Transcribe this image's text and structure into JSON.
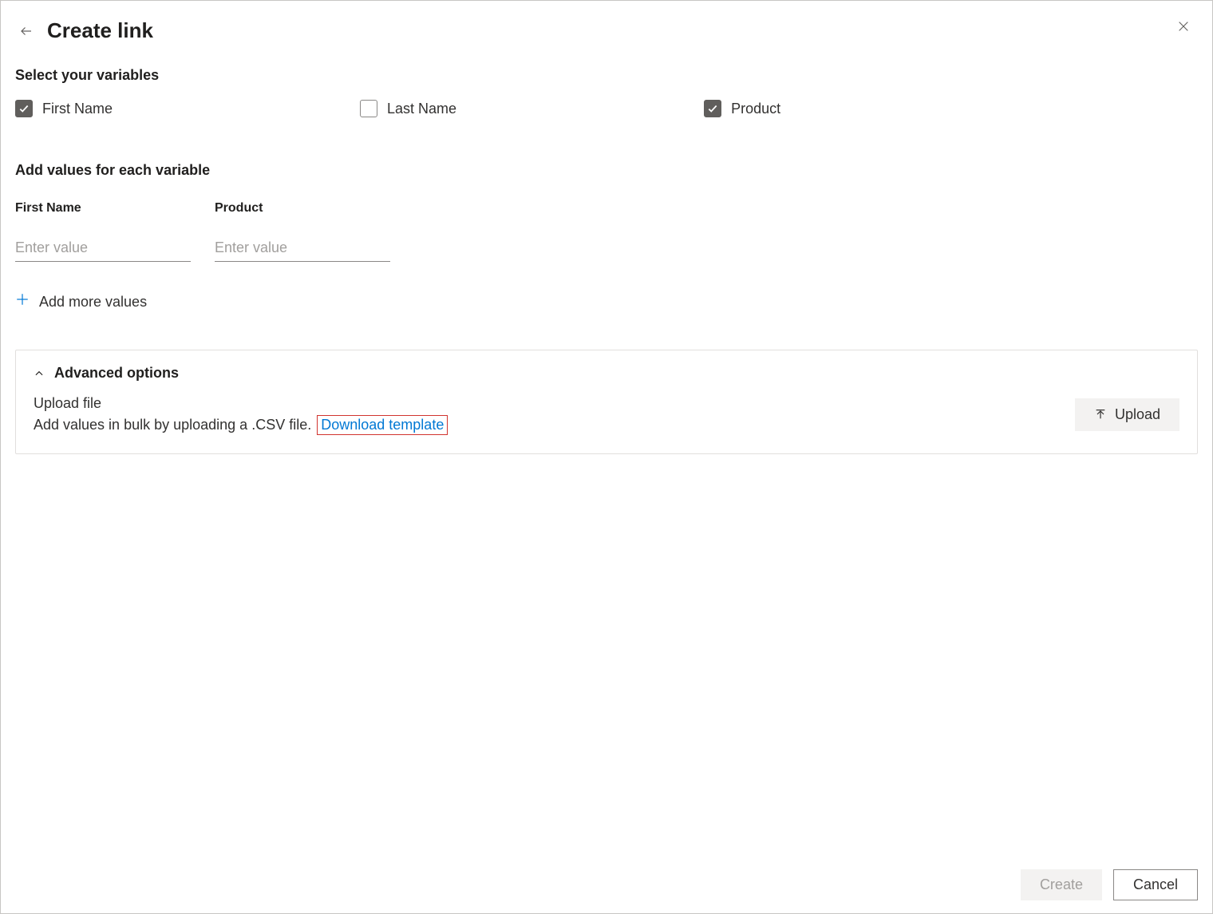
{
  "header": {
    "title": "Create link"
  },
  "sections": {
    "select_vars_heading": "Select your variables",
    "add_values_heading": "Add values for each variable"
  },
  "variables": [
    {
      "label": "First Name",
      "checked": true
    },
    {
      "label": "Last Name",
      "checked": false
    },
    {
      "label": "Product",
      "checked": true
    }
  ],
  "inputs": [
    {
      "label": "First Name",
      "placeholder": "Enter value",
      "value": ""
    },
    {
      "label": "Product",
      "placeholder": "Enter value",
      "value": ""
    }
  ],
  "add_more_label": "Add more values",
  "advanced": {
    "title": "Advanced options",
    "upload_file_label": "Upload file",
    "bulk_text": "Add values in bulk by uploading a .CSV file.",
    "download_template_label": "Download template",
    "upload_button_label": "Upload"
  },
  "footer": {
    "create_label": "Create",
    "cancel_label": "Cancel"
  }
}
